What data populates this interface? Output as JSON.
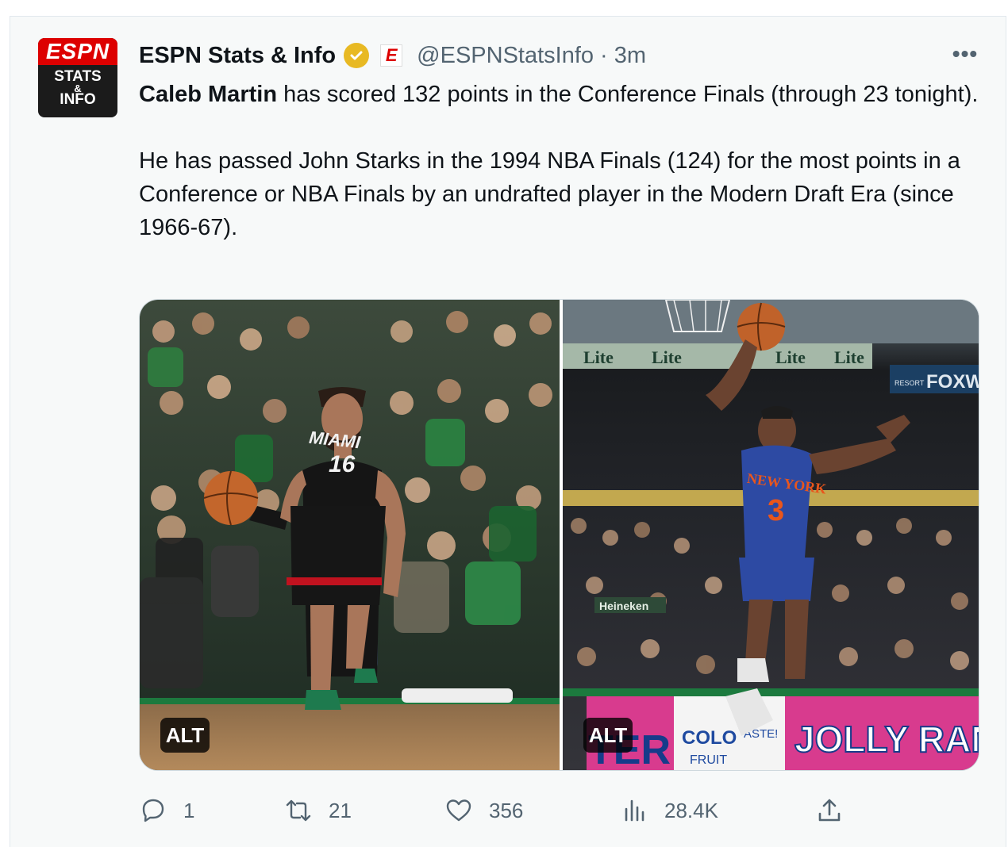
{
  "tweet": {
    "author_name": "ESPN Stats & Info",
    "verified_badge": "verified-badge-icon",
    "affiliate_badge": "E",
    "handle": "@ESPNStatsInfo",
    "separator": "·",
    "time": "3m",
    "more_label": "•••",
    "avatar": {
      "logo": "ESPN",
      "line1": "STATS",
      "line2": "&",
      "line3": "INFO"
    },
    "text": {
      "lead_name": "Caleb Martin",
      "para1_rest": " has scored 132 points in the Conference Finals (through 23 tonight).",
      "para2": "He has passed John Starks in the 1994 NBA Finals (124) for the most points in a Conference or NBA Finals by an undrafted player in the Modern Draft Era (since 1966-67)."
    },
    "media": [
      {
        "alt_label": "ALT",
        "jersey_team": "MIAMI",
        "jersey_number": "16"
      },
      {
        "alt_label": "ALT",
        "jersey_team": "NEW YORK",
        "jersey_number": "3",
        "banner_1": "Lite",
        "banner_2": "FOXW",
        "ad_1": "JOLLY RAN",
        "ad_2": "COLO",
        "ad_3": "FRUIT",
        "ad_4": "ASTE!",
        "ad_5": "TER",
        "ad_6": "Heineken",
        "ad_7": "RESORT"
      }
    ],
    "actions": {
      "reply": {
        "icon": "reply-icon",
        "count": "1"
      },
      "retweet": {
        "icon": "retweet-icon",
        "count": "21"
      },
      "like": {
        "icon": "heart-icon",
        "count": "356"
      },
      "views": {
        "icon": "analytics-icon",
        "count": "28.4K"
      },
      "share": {
        "icon": "share-icon"
      }
    }
  },
  "colors": {
    "brand_red": "#dd0000",
    "verified_gold": "#e8b923",
    "text_primary": "#0f1419",
    "text_secondary": "#536471"
  }
}
